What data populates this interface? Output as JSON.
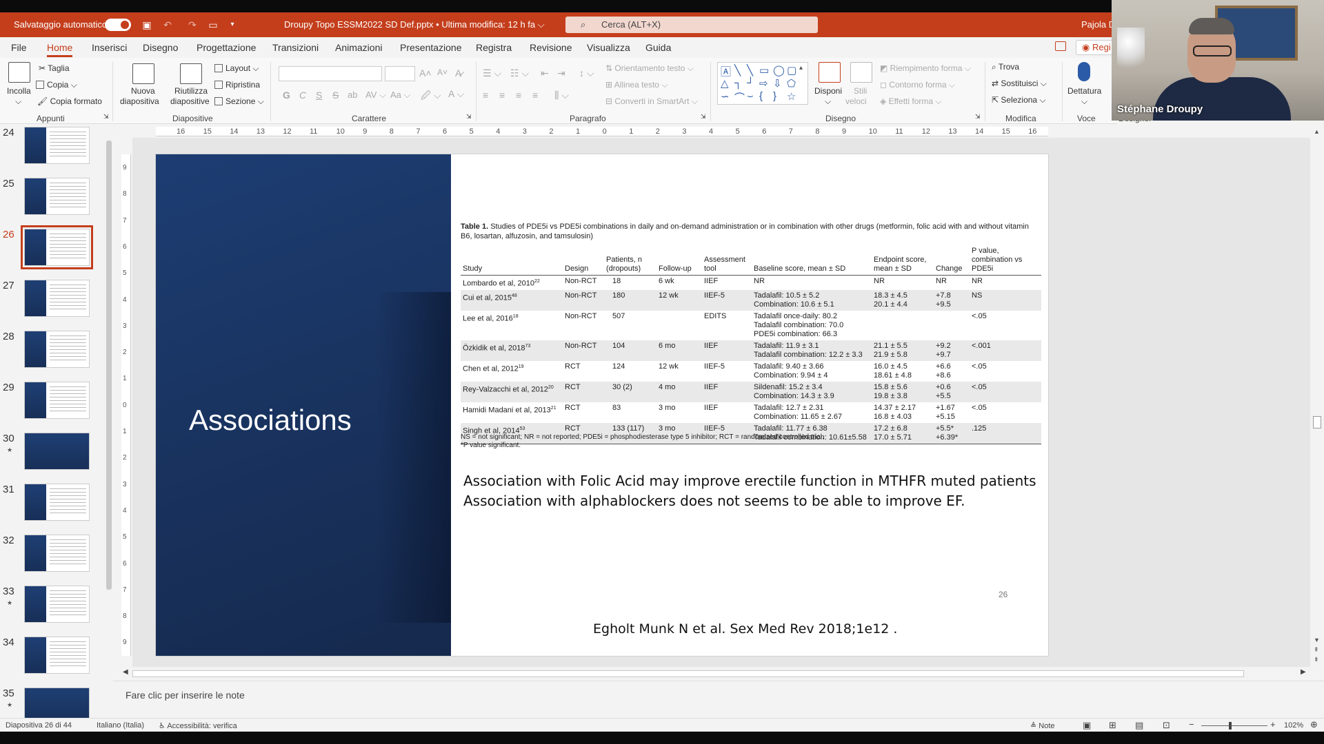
{
  "titlebar": {
    "autosave_label": "Salvataggio automatico",
    "doc_title": "Droupy Topo ESSM2022 SD Def.pptx • Ultima modifica: 12 h fa ⌵",
    "search_placeholder": "Cerca (ALT+X)",
    "user_label": "Pajola D"
  },
  "menu": {
    "tabs": [
      "File",
      "Home",
      "Inserisci",
      "Disegno",
      "Progettazione",
      "Transizioni",
      "Animazioni",
      "Presentazione",
      "Registra",
      "Revisione",
      "Visualizza",
      "Guida"
    ],
    "active_tab": "Home",
    "record_label": "Regi"
  },
  "ribbon": {
    "appunti": {
      "label": "Appunti",
      "paste": "Incolla",
      "cut": "Taglia",
      "copy": "Copia",
      "format_painter": "Copia formato"
    },
    "diapositive": {
      "label": "Diapositive",
      "new_slide_1": "Nuova",
      "new_slide_2": "diapositiva",
      "reuse_1": "Riutilizza",
      "reuse_2": "diapositive",
      "layout": "Layout",
      "reset": "Ripristina",
      "section": "Sezione"
    },
    "carattere": {
      "label": "Carattere",
      "bold": "G",
      "italic": "C",
      "underline": "S",
      "strike": "S"
    },
    "paragrafo": {
      "label": "Paragrafo",
      "text_direction": "Orientamento testo",
      "align_text": "Allinea testo",
      "smartart": "Converti in SmartArt"
    },
    "disegno": {
      "label": "Disegno",
      "arrange": "Disponi",
      "quick_styles_1": "Stili",
      "quick_styles_2": "veloci",
      "fill": "Riempimento forma",
      "outline": "Contorno forma",
      "effects": "Effetti forma"
    },
    "modifica": {
      "label": "Modifica",
      "find": "Trova",
      "replace": "Sostituisci",
      "select": "Seleziona"
    },
    "voce": {
      "label": "Voce",
      "dictate": "Dettatura"
    },
    "designer_label": "Designer"
  },
  "webcam": {
    "name": "Stéphane Droupy"
  },
  "thumbnails": [
    {
      "num": "24",
      "star": false,
      "style": "blue-text"
    },
    {
      "num": "25",
      "star": false,
      "style": "blue-text"
    },
    {
      "num": "26",
      "star": false,
      "style": "blue-table",
      "selected": true
    },
    {
      "num": "27",
      "star": false,
      "style": "blue-text"
    },
    {
      "num": "28",
      "star": false,
      "style": "blue-text"
    },
    {
      "num": "29",
      "star": false,
      "style": "blue-text"
    },
    {
      "num": "30",
      "star": true,
      "style": "full-blue"
    },
    {
      "num": "31",
      "star": false,
      "style": "blue-chart"
    },
    {
      "num": "32",
      "star": false,
      "style": "blue-text"
    },
    {
      "num": "33",
      "star": true,
      "style": "blue-text"
    },
    {
      "num": "34",
      "star": false,
      "style": "blue-text"
    },
    {
      "num": "35",
      "star": true,
      "style": "full-blue"
    }
  ],
  "ruler": {
    "horizontal": [
      "16",
      "15",
      "14",
      "13",
      "12",
      "11",
      "10",
      "9",
      "8",
      "7",
      "6",
      "5",
      "4",
      "3",
      "2",
      "1",
      "0",
      "1",
      "2",
      "3",
      "4",
      "5",
      "6",
      "7",
      "8",
      "9",
      "10",
      "11",
      "12",
      "13",
      "14",
      "15",
      "16"
    ],
    "vertical": [
      "9",
      "8",
      "7",
      "6",
      "5",
      "4",
      "3",
      "2",
      "1",
      "0",
      "1",
      "2",
      "3",
      "4",
      "5",
      "6",
      "7",
      "8",
      "9"
    ]
  },
  "slide": {
    "heading": "Associations",
    "table_caption_bold": "Table 1.",
    "table_caption": " Studies of PDE5i vs PDE5i combinations in daily and on-demand administration or in combination with other drugs (metformin, folic acid with and without vitamin B6, losartan, alfuzosin, and tamsulosin)",
    "table_headers": [
      "Study",
      "Design",
      "Patients, n (dropouts)",
      "Follow-up",
      "Assessment tool",
      "Baseline score, mean ± SD",
      "Endpoint score, mean ± SD",
      "Change",
      "P value, combination vs PDE5i"
    ],
    "table_rows": [
      {
        "study": "Lombardo et al, 2010",
        "ref": "22",
        "design": "Non-RCT",
        "patients": "18",
        "followup": "6 wk",
        "tool": "IIEF",
        "baseline": [
          "NR"
        ],
        "endpoint": [
          "NR"
        ],
        "change": [
          "NR"
        ],
        "p": "NR"
      },
      {
        "study": "Cui et al, 2015",
        "ref": "48",
        "design": "Non-RCT",
        "patients": "180",
        "followup": "12 wk",
        "tool": "IIEF-5",
        "baseline": [
          "Tadalafil: 10.5 ± 5.2",
          "Combination: 10.6 ± 5.1"
        ],
        "endpoint": [
          "18.3 ± 4.5",
          "20.1 ± 4.4"
        ],
        "change": [
          "+7.8",
          "+9.5"
        ],
        "p": "NS"
      },
      {
        "study": "Lee et al, 2016",
        "ref": "18",
        "design": "Non-RCT",
        "patients": "507",
        "followup": "",
        "tool": "EDITS",
        "baseline": [
          "Tadalafil once-daily: 80.2",
          "Tadalafil combination: 70.0",
          "PDE5i combination: 66.3"
        ],
        "endpoint": [],
        "change": [],
        "p": "<.05"
      },
      {
        "study": "Özkidik et al, 2018",
        "ref": "73",
        "design": "Non-RCT",
        "patients": "104",
        "followup": "6 mo",
        "tool": "IIEF",
        "baseline": [
          "Tadalafil: 11.9 ± 3.1",
          "Tadalafil combination: 12.2 ± 3.3"
        ],
        "endpoint": [
          "21.1 ± 5.5",
          "21.9 ± 5.8"
        ],
        "change": [
          "+9.2",
          "+9.7"
        ],
        "p": "<.001"
      },
      {
        "study": "Chen et al, 2012",
        "ref": "19",
        "design": "RCT",
        "patients": "124",
        "followup": "12 wk",
        "tool": "IIEF-5",
        "baseline": [
          "Tadalafil: 9.40 ± 3.66",
          "Combination: 9.94 ± 4"
        ],
        "endpoint": [
          "16.0 ± 4.5",
          "18.61 ± 4.8"
        ],
        "change": [
          "+6.6",
          "+8.6"
        ],
        "p": "<.05"
      },
      {
        "study": "Rey-Valzacchi et al, 2012",
        "ref": "20",
        "design": "RCT",
        "patients": "30 (2)",
        "followup": "4 mo",
        "tool": "IIEF",
        "baseline": [
          "Sildenafil: 15.2 ± 3.4",
          "Combination: 14.3 ± 3.9"
        ],
        "endpoint": [
          "15.8 ± 5.6",
          "19.8 ± 3.8"
        ],
        "change": [
          "+0.6",
          "+5.5"
        ],
        "p": "<.05"
      },
      {
        "study": "Hamidi Madani et al, 2013",
        "ref": "21",
        "design": "RCT",
        "patients": "83",
        "followup": "3 mo",
        "tool": "IIEF",
        "baseline": [
          "Tadalafil: 12.7 ± 2.31",
          "Combination: 11.65 ± 2.67"
        ],
        "endpoint": [
          "14.37 ± 2.17",
          "16.8 ± 4.03"
        ],
        "change": [
          "+1.67",
          "+5.15"
        ],
        "p": "<.05"
      },
      {
        "study": "Singh et al, 2014",
        "ref": "53",
        "design": "RCT",
        "patients": "133 (117)",
        "followup": "3 mo",
        "tool": "IIEF-5",
        "baseline": [
          "Tadalafil: 11.77 ± 6.38",
          "Tadalafil combination: 10.61±5.58"
        ],
        "endpoint": [
          "17.2 ± 6.8",
          "17.0 ± 5.71"
        ],
        "change": [
          "+5.5*",
          "+6.39*"
        ],
        "p": ".125"
      }
    ],
    "table_footnote_1": "NS = not significant; NR = not reported; PDE5i = phosphodiesterase type 5 inhibitor; RCT = randomized controlled trial.",
    "table_footnote_2": "*P value significant.",
    "assoc_line_1": "Association with Folic Acid may improve erectile function in MTHFR muted patients",
    "assoc_line_2": "Association with alphablockers does not seems to be able to improve EF.",
    "page_number": "26",
    "citation": "Egholt Munk N et al.  Sex Med Rev 2018;1e12 ."
  },
  "notes": {
    "placeholder": "Fare clic per inserire le note"
  },
  "status": {
    "slide_of": "Diapositiva 26 di 44",
    "language": "Italiano (Italia)",
    "accessibility": "Accessibilità: verifica",
    "notes_btn": "Note",
    "zoom": "102%"
  }
}
